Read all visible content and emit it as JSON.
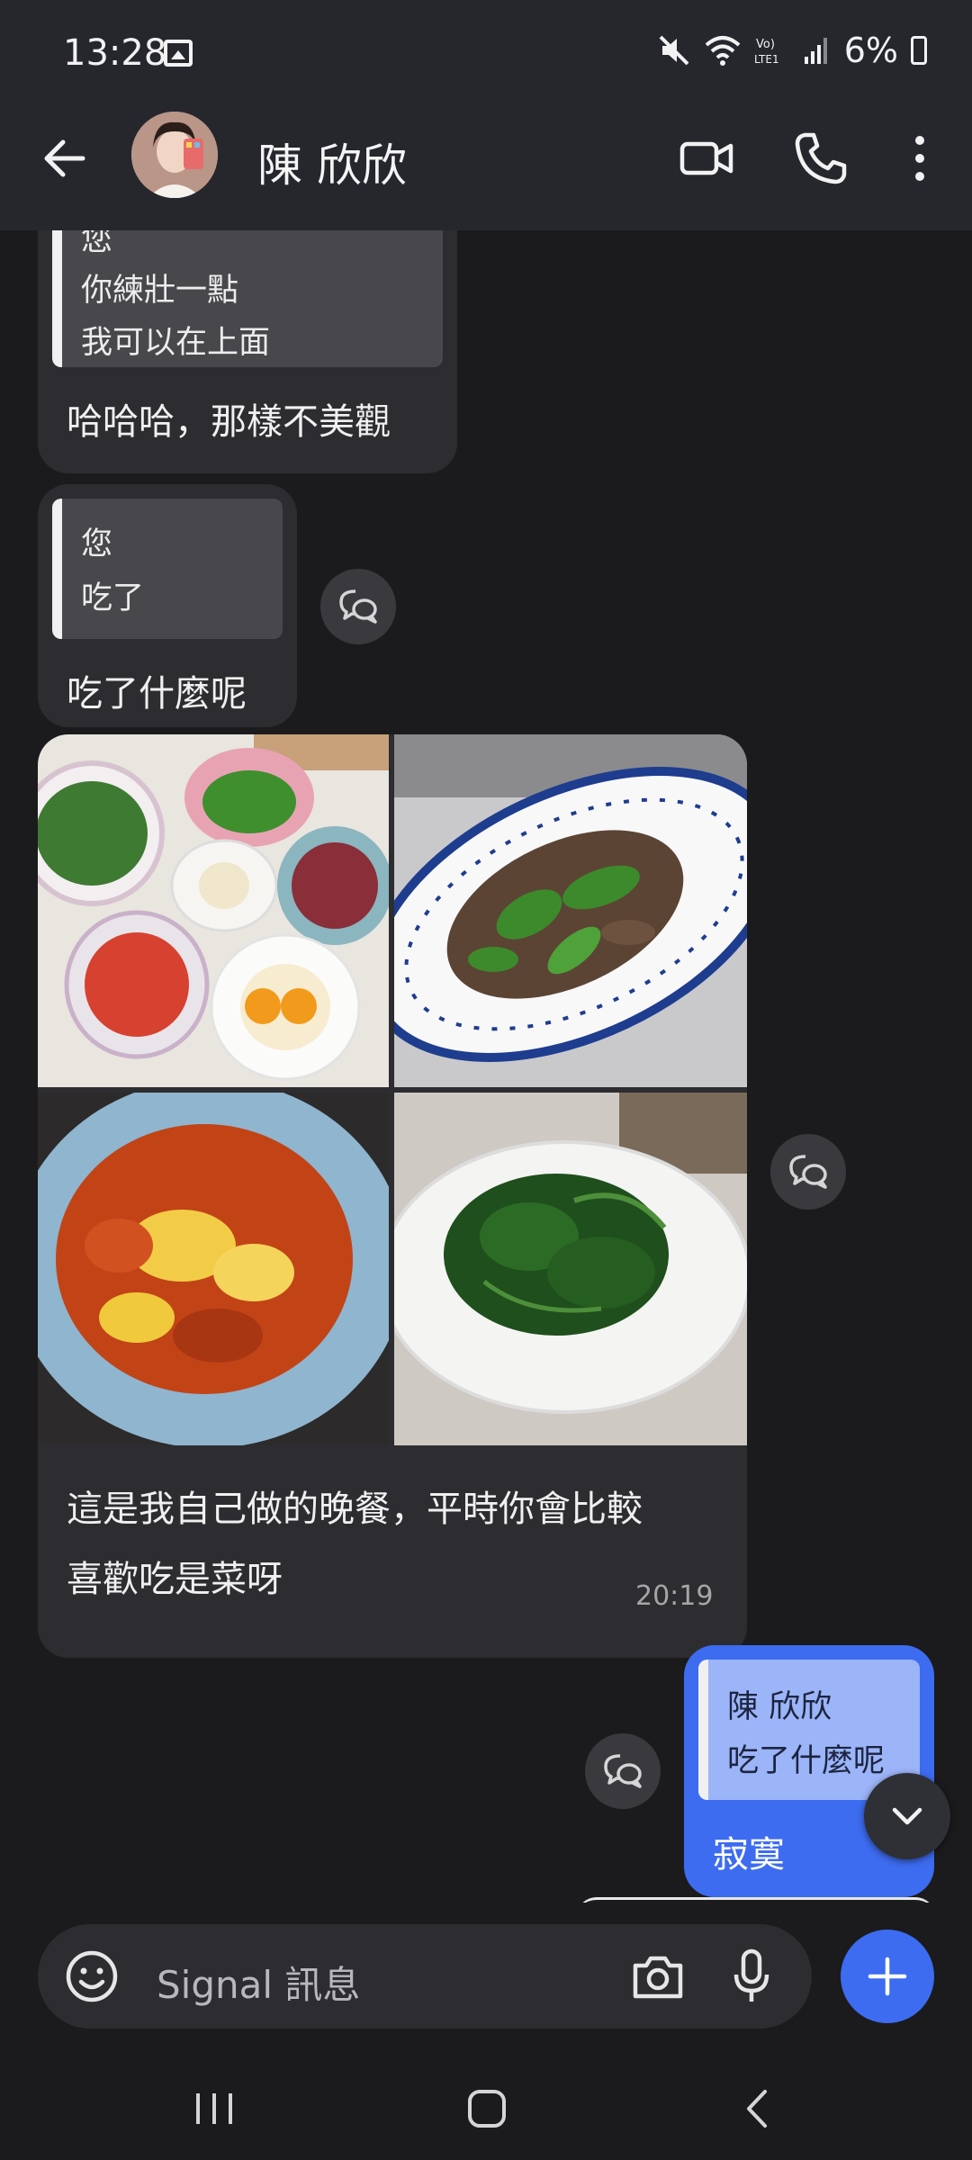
{
  "status_bar": {
    "time": "13:28",
    "battery": "6%"
  },
  "header": {
    "contact_name": "陳 欣欣"
  },
  "messages": [
    {
      "type": "incoming",
      "quote_lines": [
        "您",
        "你練壯一點",
        "我可以在上面"
      ],
      "text": "哈哈哈，那樣不美觀"
    },
    {
      "type": "incoming",
      "quote_lines": [
        "您",
        "吃了"
      ],
      "text": "吃了什麼呢"
    },
    {
      "type": "incoming",
      "photos": [
        "ingredients-photo",
        "pepper-beef-photo",
        "tomato-egg-photo",
        "spinach-photo"
      ],
      "text_lines": [
        "這是我自己做的晚餐，平時你會比較",
        "喜歡吃是菜呀"
      ],
      "time": "20:19"
    },
    {
      "type": "outgoing",
      "quote_lines": [
        "陳 欣欣",
        "吃了什麼呢"
      ],
      "text": "寂寞"
    }
  ],
  "composer": {
    "placeholder": "Signal 訊息"
  },
  "colors": {
    "outgoing_bubble": "#3d6cf0",
    "incoming_bubble": "#2d2d31",
    "background": "#1b1b1d"
  }
}
